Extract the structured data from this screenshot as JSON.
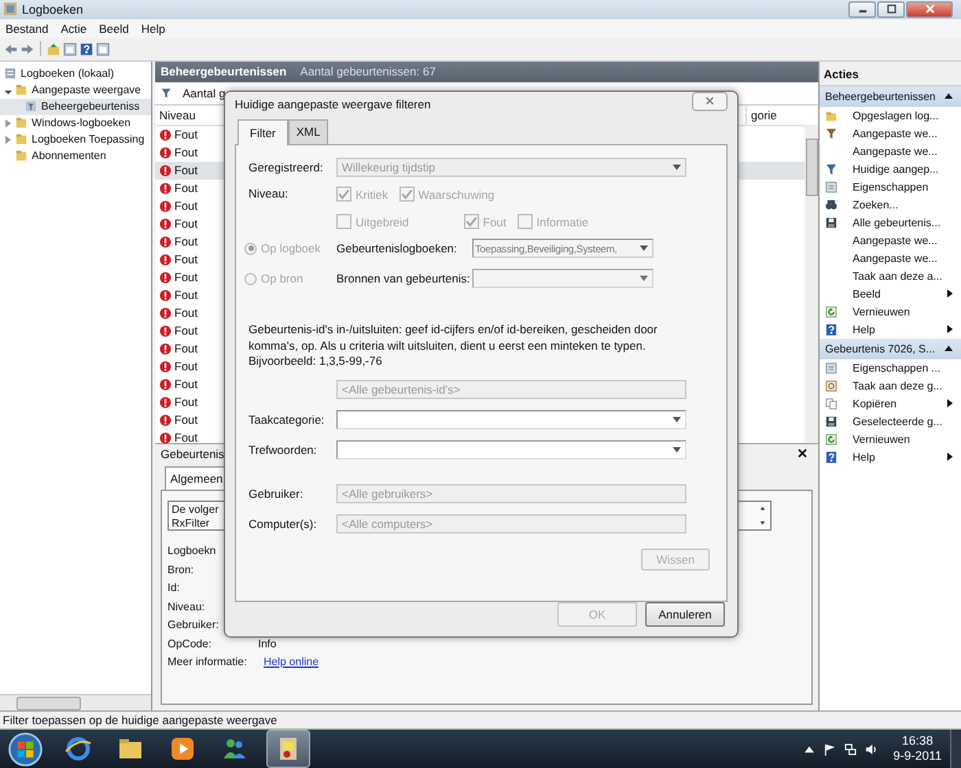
{
  "window": {
    "title": "Logboeken"
  },
  "menu": [
    "Bestand",
    "Actie",
    "Beeld",
    "Help"
  ],
  "tree": [
    {
      "label": "Logboeken (lokaal)",
      "selected": false,
      "children": [
        {
          "label": "Aangepaste weergave",
          "selected": false,
          "expanded": true,
          "children": [
            {
              "label": "Beheergebeurteniss",
              "selected": true
            }
          ]
        },
        {
          "label": "Windows-logboeken",
          "selected": false,
          "expanded": false
        },
        {
          "label": "Logboeken Toepassing",
          "selected": false,
          "expanded": false
        },
        {
          "label": "Abonnementen",
          "selected": false
        }
      ]
    }
  ],
  "view": {
    "title": "Beheergebeurtenissen",
    "count": "Aantal gebeurtenissen: 67",
    "filter_text": "Aantal g",
    "columns": [
      "Niveau",
      "gorie"
    ],
    "rows": [
      {
        "level": "Fout",
        "selected": false
      },
      {
        "level": "Fout",
        "selected": false
      },
      {
        "level": "Fout",
        "selected": true
      },
      {
        "level": "Fout",
        "selected": false
      },
      {
        "level": "Fout",
        "selected": false
      },
      {
        "level": "Fout",
        "selected": false
      },
      {
        "level": "Fout",
        "selected": false
      },
      {
        "level": "Fout",
        "selected": false
      },
      {
        "level": "Fout",
        "selected": false
      },
      {
        "level": "Fout",
        "selected": false
      },
      {
        "level": "Fout",
        "selected": false
      },
      {
        "level": "Fout",
        "selected": false
      },
      {
        "level": "Fout",
        "selected": false
      },
      {
        "level": "Fout",
        "selected": false
      },
      {
        "level": "Fout",
        "selected": false
      },
      {
        "level": "Fout",
        "selected": false
      },
      {
        "level": "Fout",
        "selected": false
      },
      {
        "level": "Fout",
        "selected": false
      }
    ]
  },
  "details": {
    "title": "Gebeurtenis",
    "tab": "Algemeen",
    "message": [
      "De volger",
      "RxFilter"
    ],
    "fields": [
      {
        "label": "Logboekn"
      },
      {
        "label": "Bron:"
      },
      {
        "label": "Id:"
      },
      {
        "label": "Niveau:"
      },
      {
        "label": "Gebruiker:"
      },
      {
        "label": "OpCode:",
        "value": "Info"
      },
      {
        "label": "Meer informatie:",
        "link": "Help online"
      }
    ]
  },
  "actions": {
    "title": "Acties",
    "sections": [
      {
        "title": "Beheergebeurtenissen",
        "items": [
          {
            "label": "Opgeslagen log...",
            "kind": "folder",
            "submenu": false
          },
          {
            "label": "Aangepaste we...",
            "kind": "filter",
            "submenu": false
          },
          {
            "label": "Aangepaste we...",
            "kind": "plain",
            "submenu": false
          },
          {
            "label": "Huidige aangep...",
            "kind": "filter-blue",
            "submenu": false
          },
          {
            "label": "Eigenschappen",
            "kind": "properties",
            "submenu": false
          },
          {
            "label": "Zoeken...",
            "kind": "find",
            "submenu": false
          },
          {
            "label": "Alle gebeurtenis...",
            "kind": "save",
            "submenu": false
          },
          {
            "label": "Aangepaste we...",
            "kind": "plain",
            "submenu": false
          },
          {
            "label": "Aangepaste we...",
            "kind": "plain",
            "submenu": false
          },
          {
            "label": "Taak aan deze a...",
            "kind": "plain",
            "submenu": false
          },
          {
            "label": "Beeld",
            "kind": "plain",
            "submenu": true
          },
          {
            "label": "Vernieuwen",
            "kind": "refresh",
            "submenu": false
          },
          {
            "label": "Help",
            "kind": "help",
            "submenu": true
          }
        ]
      },
      {
        "title": "Gebeurtenis 7026, S...",
        "items": [
          {
            "label": "Eigenschappen ...",
            "kind": "properties",
            "submenu": false
          },
          {
            "label": "Taak aan deze g...",
            "kind": "task",
            "submenu": false
          },
          {
            "label": "Kopiëren",
            "kind": "copy",
            "submenu": true
          },
          {
            "label": "Geselecteerde g...",
            "kind": "save",
            "submenu": false
          },
          {
            "label": "Vernieuwen",
            "kind": "refresh",
            "submenu": false
          },
          {
            "label": "Help",
            "kind": "help",
            "submenu": true
          }
        ]
      }
    ]
  },
  "dialog": {
    "title": "Huidige aangepaste weergave filteren",
    "tabs": [
      {
        "label": "Filter",
        "selected": true
      },
      {
        "label": "XML",
        "selected": false
      }
    ],
    "logged": {
      "label": "Geregistreerd:",
      "value": "Willekeurig tijdstip"
    },
    "level": {
      "label": "Niveau:",
      "disabled": true,
      "options": [
        {
          "label": "Kritiek",
          "checked": true
        },
        {
          "label": "Waarschuwing",
          "checked": true
        },
        {
          "label": "Uitgebreid",
          "checked": false
        },
        {
          "label": "Fout",
          "checked": true
        },
        {
          "label": "Informatie",
          "checked": false
        }
      ]
    },
    "scope": [
      {
        "label": "Op logboek",
        "selected": true,
        "disabled": true,
        "field_label": "Gebeurtenislogboeken:",
        "value": "Toepassing,Beveiliging,Systeem,"
      },
      {
        "label": "Op bron",
        "selected": false,
        "disabled": true,
        "field_label": "Bronnen van gebeurtenis:"
      }
    ],
    "ids_help": "Gebeurtenis-id's in-/uitsluiten: geef id-cijfers en/of id-bereiken, gescheiden door komma's, op. Als u criteria wilt uitsluiten, dient u eerst een minteken te typen. Bijvoorbeeld: 1,3,5-99,-76",
    "ids": {
      "placeholder": "<Alle gebeurtenis-id's>"
    },
    "task": {
      "label": "Taakcategorie:"
    },
    "keywords": {
      "label": "Trefwoorden:"
    },
    "user": {
      "label": "Gebruiker:",
      "placeholder": "<Alle gebruikers>"
    },
    "computer": {
      "label": "Computer(s):",
      "placeholder": "<Alle computers>"
    },
    "clear": {
      "label": "Wissen",
      "disabled": true
    },
    "buttons": [
      {
        "label": "OK",
        "disabled": true
      },
      {
        "label": "Annuleren",
        "disabled": false
      }
    ]
  },
  "status_bar": "Filter toepassen op de huidige aangepaste weergave",
  "taskbar": {
    "apps": [
      {
        "kind": "browser",
        "selected": false
      },
      {
        "kind": "folder",
        "selected": false
      },
      {
        "kind": "media",
        "selected": false
      },
      {
        "kind": "people",
        "selected": false
      },
      {
        "kind": "eventlog",
        "selected": true
      }
    ],
    "time": "16:38",
    "date": "9-9-2011"
  }
}
